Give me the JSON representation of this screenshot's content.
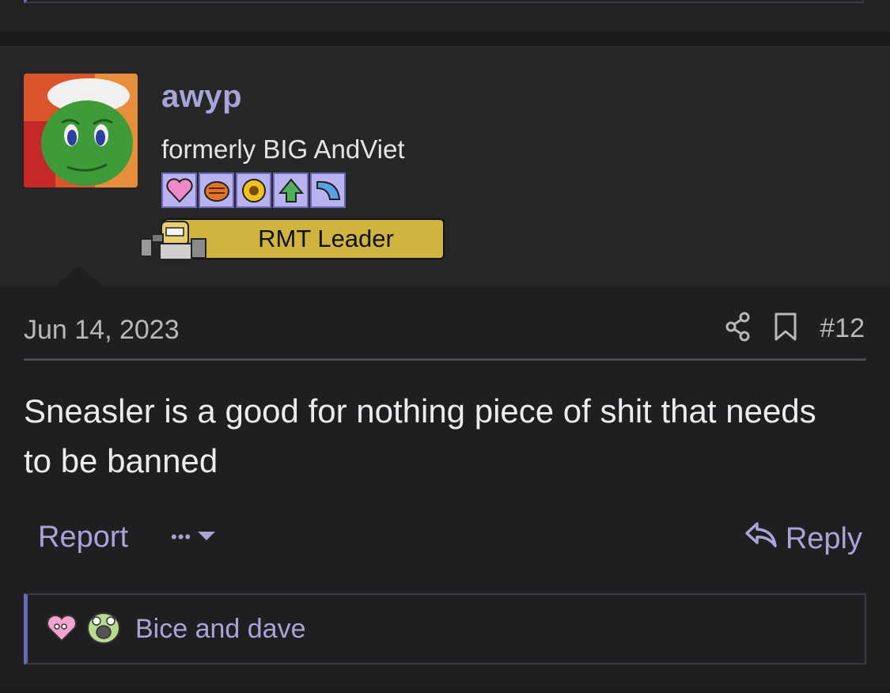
{
  "user": {
    "name": "awyp",
    "title": "formerly BIG AndViet",
    "badges": [
      "heart-badge-icon",
      "baseball-glove-badge-icon",
      "sunflower-badge-icon",
      "leaf-badge-icon",
      "wing-badge-icon"
    ],
    "role": "RMT Leader"
  },
  "post": {
    "date": "Jun 14, 2023",
    "number": "#12",
    "body": "Sneasler is a good for nothing piece of shit that needs to be banned"
  },
  "actions": {
    "report": "Report",
    "more": "•••",
    "reply": "Reply"
  },
  "reactions": {
    "text": "Bice and dave"
  },
  "colors": {
    "accent": "#a8a4d8",
    "accent_border": "#6c67b5",
    "role_banner": "#d0b440",
    "background": "#1f1f21"
  }
}
